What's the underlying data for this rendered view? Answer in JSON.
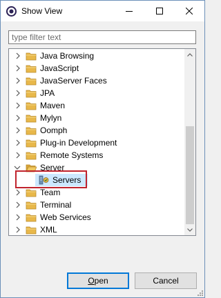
{
  "window": {
    "title": "Show View"
  },
  "filter": {
    "placeholder": "type filter text",
    "value": ""
  },
  "tree": {
    "items": [
      {
        "label": "Java Browsing",
        "expanded": false
      },
      {
        "label": "JavaScript",
        "expanded": false
      },
      {
        "label": "JavaServer Faces",
        "expanded": false
      },
      {
        "label": "JPA",
        "expanded": false
      },
      {
        "label": "Maven",
        "expanded": false
      },
      {
        "label": "Mylyn",
        "expanded": false
      },
      {
        "label": "Oomph",
        "expanded": false
      },
      {
        "label": "Plug-in Development",
        "expanded": false
      },
      {
        "label": "Remote Systems",
        "expanded": false
      },
      {
        "label": "Server",
        "expanded": true
      },
      {
        "label": "Servers",
        "child": true,
        "selected": true
      },
      {
        "label": "Team",
        "expanded": false
      },
      {
        "label": "Terminal",
        "expanded": false
      },
      {
        "label": "Web Services",
        "expanded": false
      },
      {
        "label": "XML",
        "expanded": false
      }
    ]
  },
  "buttons": {
    "open_first": "O",
    "open_rest": "pen",
    "cancel": "Cancel"
  },
  "colors": {
    "folder": "#e8b84a",
    "selection": "#cce8ff",
    "highlight": "#c0232d",
    "default_button_border": "#0078d7"
  }
}
